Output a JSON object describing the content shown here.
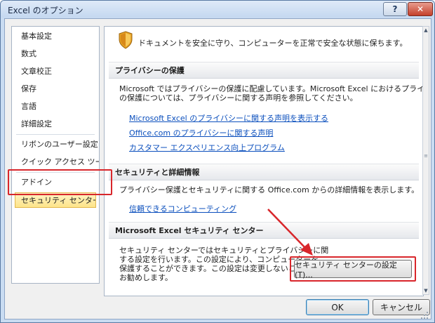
{
  "window": {
    "title": "Excel のオプション",
    "help_label": "?",
    "close_label": "✕"
  },
  "sidebar": {
    "items": [
      {
        "label": "基本設定"
      },
      {
        "label": "数式"
      },
      {
        "label": "文章校正"
      },
      {
        "label": "保存"
      },
      {
        "label": "言語"
      },
      {
        "label": "詳細設定"
      },
      {
        "label": "リボンのユーザー設定"
      },
      {
        "label": "クイック アクセス ツール ."
      },
      {
        "label": "アドイン"
      },
      {
        "label": "セキュリティ センター",
        "selected": true
      }
    ]
  },
  "content": {
    "intro_icon": "shield-icon",
    "intro_text": "ドキュメントを安全に守り、コンピューターを正常で安全な状態に保ちます。",
    "privacy": {
      "header": "プライバシーの保護",
      "text_line1": "Microsoft ではプライバシーの保護に配慮しています。Microsoft Excel におけるプライバシー",
      "text_line2": "の保護については、プライバシーに関する声明を参照してください。",
      "links": [
        "Microsoft Excel のプライバシーに関する声明を表示する",
        "Office.com のプライバシーに関する声明",
        "カスタマー エクスペリエンス向上プログラム"
      ]
    },
    "security": {
      "header": "セキュリティと詳細情報",
      "text": "プライバシー保護とセキュリティに関する Office.com からの詳細情報を表示します。",
      "link": "信頼できるコンピューティング"
    },
    "trust_center": {
      "header": "Microsoft Excel セキュリティ センター",
      "text_lines": [
        "セキュリティ センターではセキュリティとプライバシーに関",
        "する設定を行います。この設定により、コンピューターを",
        "保護することができます。この設定は変更しないことを",
        "お勧めします。"
      ],
      "button_label": "セキュリティ センターの設定(T)..."
    }
  },
  "footer": {
    "ok_label": "OK",
    "cancel_label": "キャンセル"
  },
  "colors": {
    "highlight": "#d8262b",
    "link": "#0b4fbd",
    "selected_bg": "#fde48a"
  }
}
